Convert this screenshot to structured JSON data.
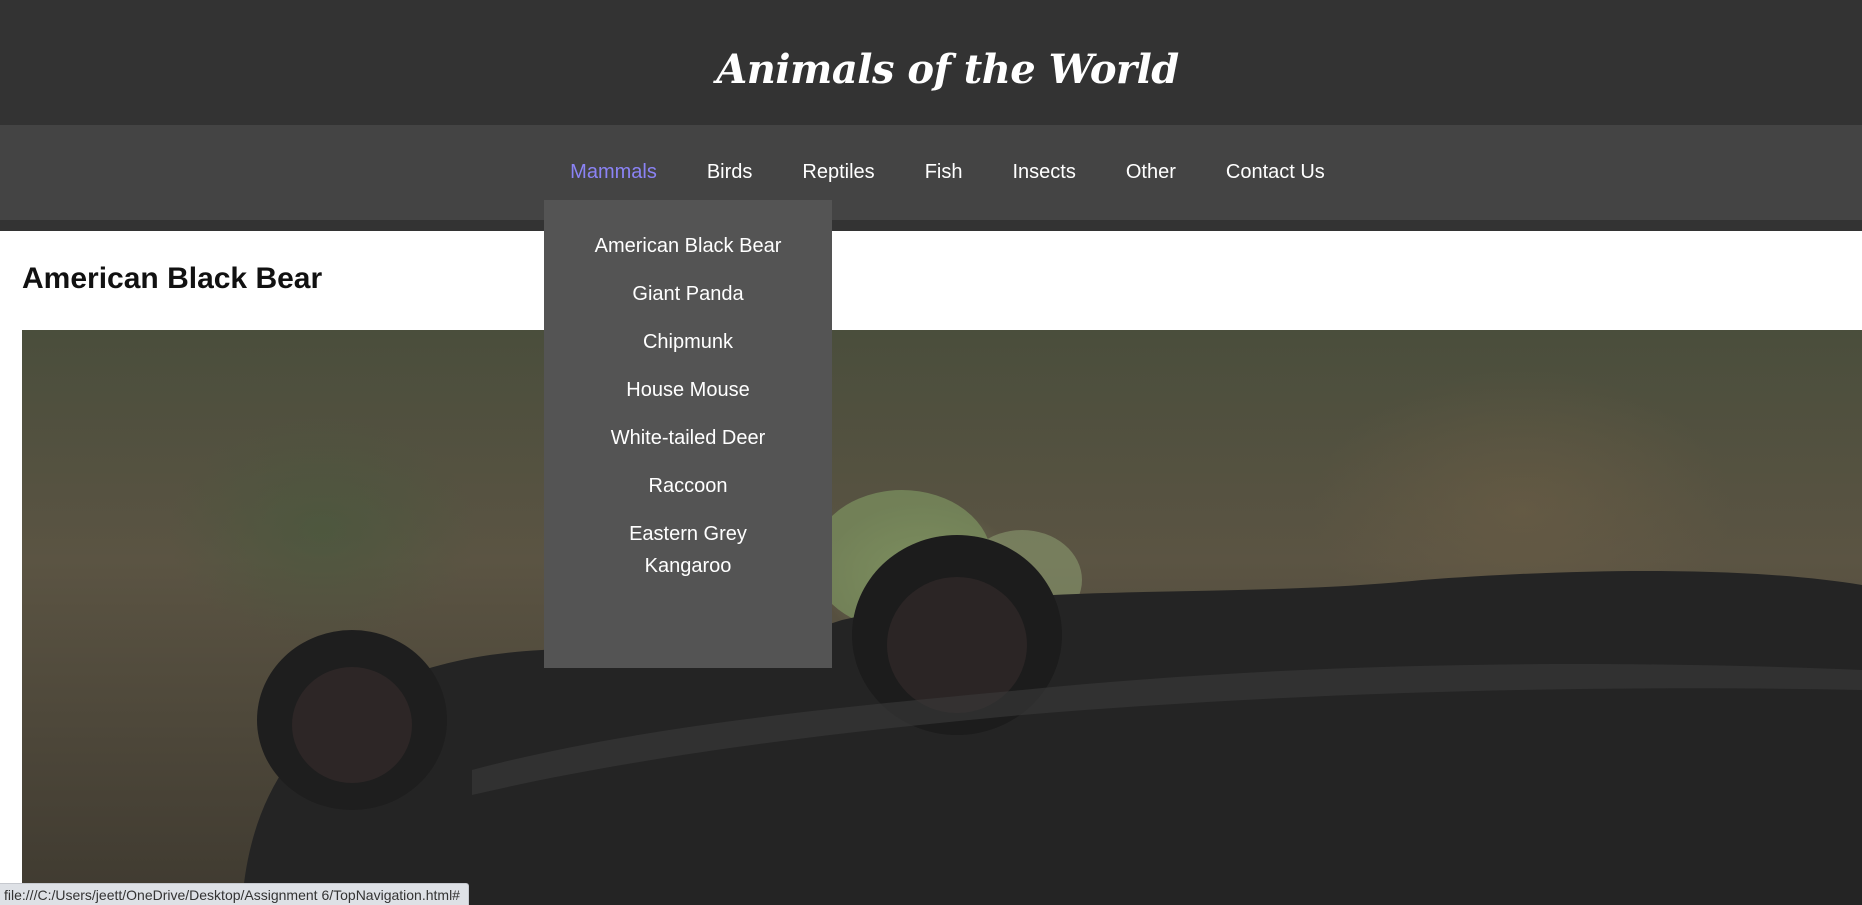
{
  "header": {
    "title": "Animals of the World"
  },
  "nav": {
    "items": [
      {
        "label": "Mammals",
        "active": true
      },
      {
        "label": "Birds"
      },
      {
        "label": "Reptiles"
      },
      {
        "label": "Fish"
      },
      {
        "label": "Insects"
      },
      {
        "label": "Other"
      },
      {
        "label": "Contact Us"
      }
    ],
    "active_color": "#8b83f5"
  },
  "dropdown": {
    "items": [
      "American Black Bear",
      "Giant Panda",
      "Chipmunk",
      "House Mouse",
      "White-tailed Deer",
      "Raccoon",
      "Eastern Grey Kangaroo"
    ]
  },
  "main": {
    "heading": "American Black Bear",
    "image_alt": "American Black Bear"
  },
  "status_bar": {
    "url": "file:///C:/Users/jeett/OneDrive/Desktop/Assignment 6/TopNavigation.html#"
  },
  "colors": {
    "header_bg": "#333333",
    "navbar_bg": "#444444",
    "dropdown_bg": "#545454"
  }
}
